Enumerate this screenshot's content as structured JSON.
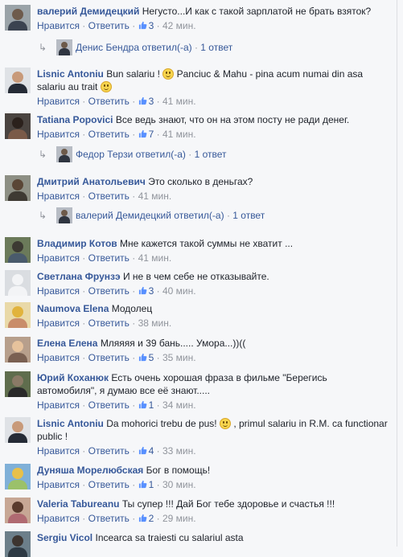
{
  "ui": {
    "like_label": "Нравится",
    "reply_label": "Ответить",
    "separator": "·"
  },
  "comments": [
    {
      "author": "валерий Демидецкий",
      "text": "Негусто...И как с такой зарплатой не брать взяток?",
      "likes": "3",
      "time": "42 мин.",
      "reply": {
        "text": "Денис Бендра ответил(-а)",
        "count": "1 ответ"
      }
    },
    {
      "author": "Lisnic Antoniu",
      "text_parts": [
        "Bun salariu ! ",
        " Panciuc & Mahu - pina acum numai din asa salariu au trait "
      ],
      "likes": "3",
      "time": "41 мин."
    },
    {
      "author": "Tatiana Popovici",
      "text": "Все ведь знают, что он на этом посту не ради денег.",
      "likes": "7",
      "time": "41 мин.",
      "reply": {
        "text": "Федор Терзи ответил(-а)",
        "count": "1 ответ"
      }
    },
    {
      "author": "Дмитрий Анатольевич",
      "text": "Это сколько в деньгах?",
      "time": "41 мин.",
      "reply": {
        "text": "валерий Демидецкий ответил(-а)",
        "count": "1 ответ"
      }
    },
    {
      "author": "Владимир Котов",
      "text": "Мне кажется такой суммы не хватит ...",
      "time": "41 мин."
    },
    {
      "author": "Светлана Фрунзэ",
      "text": "И не в чем себе не отказывайте.",
      "likes": "3",
      "time": "40 мин."
    },
    {
      "author": "Naumova Elena",
      "text": "Модолец",
      "time": "38 мин."
    },
    {
      "author": "Елена Елена",
      "text": "Мляяяя и 39 бань..... Умора...))((",
      "likes": "5",
      "time": "35 мин."
    },
    {
      "author": "Юрий Коханюк",
      "text": "Есть очень хорошая фраза в фильме \"Берегись автомобиля\", я думаю все её знают.....",
      "likes": "1",
      "time": "34 мин."
    },
    {
      "author": "Lisnic Antoniu",
      "text_parts": [
        "Da mohorici trebu de pus! ",
        " , primul salariu in R.M. ca functionar public !"
      ],
      "likes": "4",
      "time": "33 мин."
    },
    {
      "author": "Дуняша Морелюбская",
      "text": "Бог в помощь!",
      "likes": "1",
      "time": "30 мин."
    },
    {
      "author": "Valeria Tabureanu",
      "text": "Ты супер !!! Дай Бог тебе здоровье и счастья !!!",
      "likes": "2",
      "time": "29 мин."
    },
    {
      "author": "Sergiu Vicol",
      "text": "Incearca sa traiesti cu salariul asta"
    }
  ],
  "colors": {
    "link": "#365899",
    "meta": "#90949c",
    "background": "#f6f7f9"
  }
}
